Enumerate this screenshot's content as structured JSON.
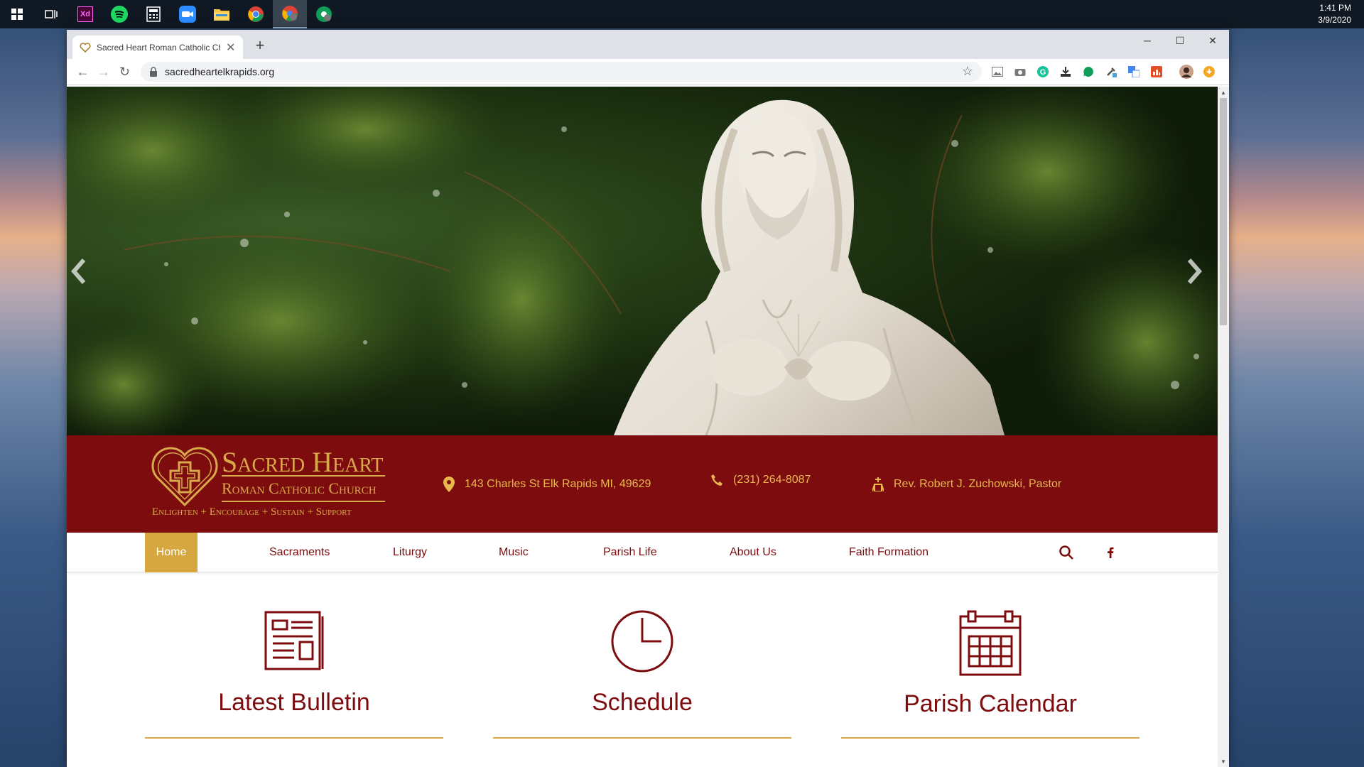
{
  "taskbar": {
    "apps": [
      "windows-start-icon",
      "task-view-icon",
      "adobe-xd-icon",
      "spotify-icon",
      "calculator-icon",
      "zoom-icon",
      "file-explorer-icon",
      "chrome-icon",
      "chrome-profile-icon",
      "chrome-profile-2-icon"
    ],
    "time": "1:41 PM",
    "date": "3/9/2020"
  },
  "browser": {
    "tab_title": "Sacred Heart Roman Catholic Church",
    "url": "sacredheartelkrapids.org"
  },
  "site": {
    "logo_title": "Sacred Heart",
    "logo_subtitle": "Roman Catholic Church",
    "logo_tagline": "Enlighten  +  Encourage  +  Sustain  +  Support",
    "address": "143 Charles St Elk Rapids MI, 49629",
    "phone": "(231) 264-8087",
    "pastor": "Rev. Robert J. Zuchowski, Pastor",
    "nav": [
      "Home",
      "Sacraments",
      "Liturgy",
      "Music",
      "Parish Life",
      "About Us",
      "Faith Formation"
    ],
    "features": [
      "Latest Bulletin",
      "Schedule",
      "Parish Calendar"
    ]
  },
  "colors": {
    "brand_red": "#7d0c0e",
    "brand_gold": "#d6a640",
    "header_text_gold": "#e8b84d"
  }
}
